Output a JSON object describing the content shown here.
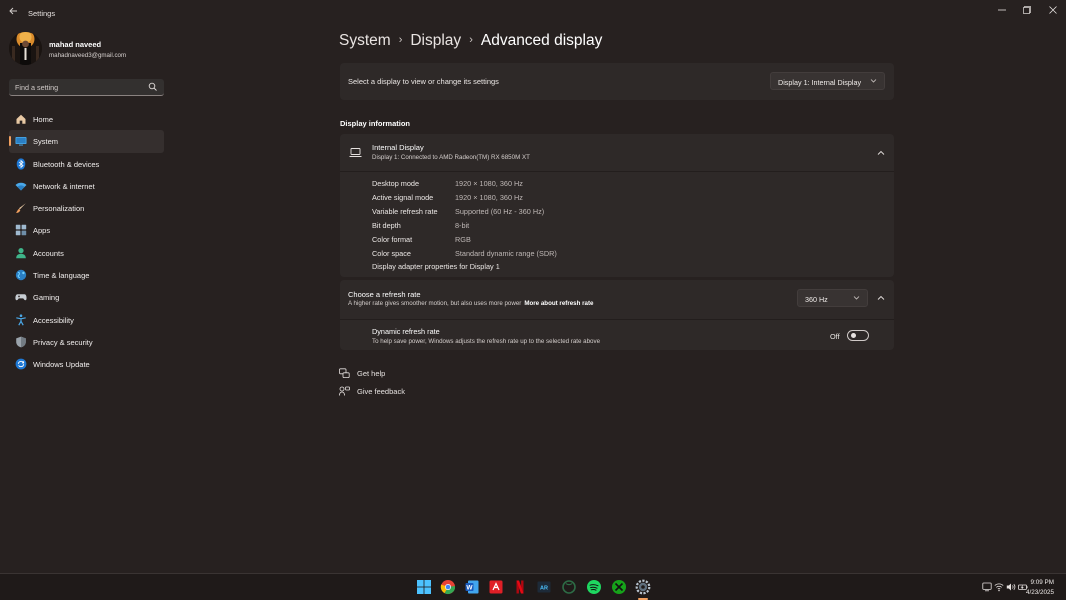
{
  "window": {
    "title": "Settings",
    "back_icon": "back-arrow-icon",
    "controls": {
      "minimize": "—",
      "maximize": "▢",
      "close": "✕"
    }
  },
  "profile": {
    "name": "mahad naveed",
    "email": "mahadnaveed3@gmail.com"
  },
  "search": {
    "placeholder": "Find a setting",
    "icon": "search-icon"
  },
  "sidebar": {
    "active": "System",
    "items": [
      {
        "label": "Home",
        "icon": "home-icon"
      },
      {
        "label": "System",
        "icon": "system-icon"
      },
      {
        "label": "Bluetooth & devices",
        "icon": "bluetooth-icon"
      },
      {
        "label": "Network & internet",
        "icon": "network-icon"
      },
      {
        "label": "Personalization",
        "icon": "brush-icon"
      },
      {
        "label": "Apps",
        "icon": "apps-icon"
      },
      {
        "label": "Accounts",
        "icon": "accounts-icon"
      },
      {
        "label": "Time & language",
        "icon": "globe-icon"
      },
      {
        "label": "Gaming",
        "icon": "gamepad-icon"
      },
      {
        "label": "Accessibility",
        "icon": "accessibility-icon"
      },
      {
        "label": "Privacy & security",
        "icon": "shield-icon"
      },
      {
        "label": "Windows Update",
        "icon": "update-icon"
      }
    ]
  },
  "breadcrumb": {
    "items": [
      "System",
      "Display",
      "Advanced display"
    ],
    "separator": "›"
  },
  "display_selector": {
    "label": "Select a display to view or change its settings",
    "value": "Display 1: Internal Display"
  },
  "display_info": {
    "section_title": "Display information",
    "title": "Internal Display",
    "subtitle": "Display 1: Connected to AMD Radeon(TM) RX 6850M XT",
    "properties": [
      {
        "key": "Desktop mode",
        "value": "1920 × 1080, 360 Hz"
      },
      {
        "key": "Active signal mode",
        "value": "1920 × 1080, 360 Hz"
      },
      {
        "key": "Variable refresh rate",
        "value": "Supported (60 Hz - 360 Hz)"
      },
      {
        "key": "Bit depth",
        "value": "8-bit"
      },
      {
        "key": "Color format",
        "value": "RGB"
      },
      {
        "key": "Color space",
        "value": "Standard dynamic range (SDR)"
      }
    ],
    "adapter_link": "Display adapter properties for Display 1"
  },
  "refresh_rate": {
    "title": "Choose a refresh rate",
    "subtitle": "A higher rate gives smoother motion, but also uses more power",
    "link": "More about refresh rate",
    "value": "360 Hz",
    "dynamic": {
      "title": "Dynamic refresh rate",
      "subtitle": "To help save power, Windows adjusts the refresh rate up to the selected rate above",
      "state_label": "Off",
      "enabled": false
    }
  },
  "help": {
    "get_help": "Get help",
    "feedback": "Give feedback"
  },
  "taskbar": {
    "apps": [
      "start-icon",
      "chrome-icon",
      "word-icon",
      "amd-software-icon",
      "netflix-icon",
      "armoury-crate-icon",
      "xbox-icon",
      "spotify-icon",
      "xbox-app-icon",
      "settings-icon"
    ],
    "time": "9:09 PM",
    "date": "4/23/2025"
  },
  "colors": {
    "background": "#272120",
    "card": "#2e2928",
    "accent": "#f2a05f",
    "taskbar": "#1f1a19"
  }
}
